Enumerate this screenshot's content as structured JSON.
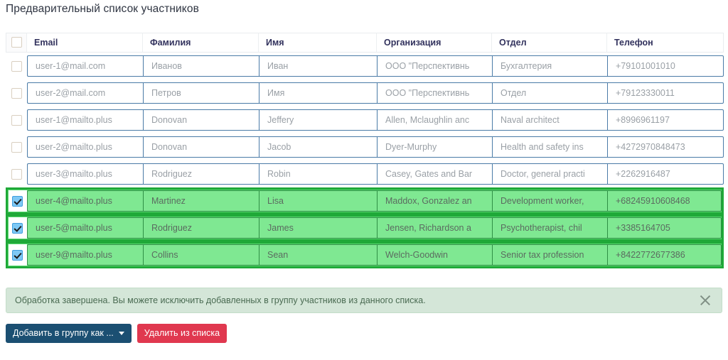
{
  "page": {
    "title": "Предварительный список участников"
  },
  "table": {
    "select_all_checked": false,
    "columns": [
      {
        "key": "email",
        "label": "Email"
      },
      {
        "key": "last_name",
        "label": "Фамилия"
      },
      {
        "key": "first_name",
        "label": "Имя"
      },
      {
        "key": "organization",
        "label": "Организация"
      },
      {
        "key": "department",
        "label": "Отдел"
      },
      {
        "key": "phone",
        "label": "Телефон"
      }
    ],
    "rows": [
      {
        "selected": false,
        "email": "user-1@mail.com",
        "last_name": "Иванов",
        "first_name": "Иван",
        "organization": "ООО \"Перспективнь",
        "department": "Бухгалтерия",
        "phone": "+79101001010"
      },
      {
        "selected": false,
        "email": "user-2@mail.com",
        "last_name": "Петров",
        "first_name": "Имя",
        "organization": "ООО \"Перспективнь",
        "department": "Отдел",
        "phone": "+79123330011"
      },
      {
        "selected": false,
        "email": "user-1@mailto.plus",
        "last_name": "Donovan",
        "first_name": "Jeffery",
        "organization": "Allen, Mclaughlin anc",
        "department": "Naval architect",
        "phone": "+8996961197"
      },
      {
        "selected": false,
        "email": "user-2@mailto.plus",
        "last_name": "Donovan",
        "first_name": "Jacob",
        "organization": "Dyer-Murphy",
        "department": "Health and safety ins",
        "phone": "+4272970848473"
      },
      {
        "selected": false,
        "email": "user-3@mailto.plus",
        "last_name": "Rodriguez",
        "first_name": "Robin",
        "organization": "Casey, Gates and Bar",
        "department": "Doctor, general practi",
        "phone": "+2262916487"
      },
      {
        "selected": true,
        "email": "user-4@mailto.plus",
        "last_name": "Martinez",
        "first_name": "Lisa",
        "organization": "Maddox, Gonzalez an",
        "department": "Development worker,",
        "phone": "+68245910608468"
      },
      {
        "selected": true,
        "email": "user-5@mailto.plus",
        "last_name": "Rodriguez",
        "first_name": "James",
        "organization": "Jensen, Richardson a",
        "department": "Psychotherapist, chil",
        "phone": "+3385164705"
      },
      {
        "selected": true,
        "email": "user-9@mailto.plus",
        "last_name": "Collins",
        "first_name": "Sean",
        "organization": "Welch-Goodwin",
        "department": "Senior tax profession",
        "phone": "+8422772677386"
      }
    ]
  },
  "alert": {
    "message": "Обработка завершена. Вы можете исключить добавленных в группу участников из данного списка.",
    "close_icon": "close-icon",
    "background_color": "#d4e6d8",
    "text_color": "#4a6b52"
  },
  "buttons": {
    "add_to_group": {
      "label": "Добавить в группу как ...",
      "color": "#1b4f72",
      "caret_icon": "chevron-down-icon"
    },
    "remove_from_list": {
      "label": "Удалить из списка",
      "color": "#e0384f"
    }
  }
}
